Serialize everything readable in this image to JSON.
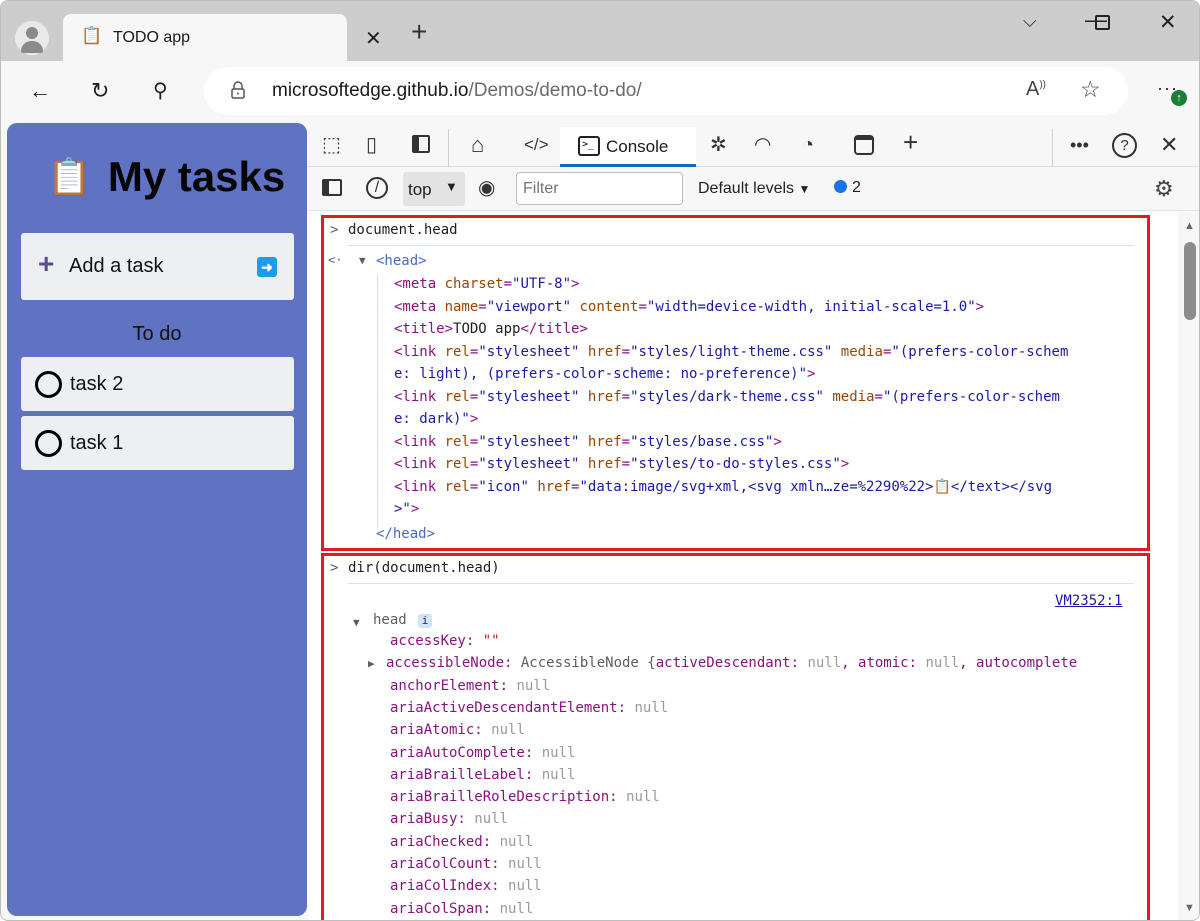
{
  "browser": {
    "tab_title": "TODO app",
    "tab_favicon": "clipboard-icon",
    "new_tab_label": "+",
    "url_host": "microsoftedge.github.io",
    "url_path": "/Demos/demo-to-do/",
    "window_controls": [
      "tab-actions-chevron",
      "minimize",
      "maximize",
      "close"
    ]
  },
  "app": {
    "title": "My tasks",
    "title_icon": "📋",
    "add_task_label": "Add a task",
    "section_heading": "To do",
    "tasks": [
      {
        "label": "task 2",
        "done": false
      },
      {
        "label": "task 1",
        "done": false
      }
    ],
    "colors": {
      "background": "#6072c2",
      "card": "#eeeff3",
      "submit": "#1e9bea"
    }
  },
  "devtools": {
    "toolbar_icons": [
      "inspect-icon",
      "device-emulation-icon",
      "dock-sidebar-icon",
      "welcome-home-icon",
      "elements-icon"
    ],
    "active_tab": "Console",
    "more_tool_icons": [
      "sources-bug-icon",
      "network-wifi-icon",
      "performance-gauge-icon",
      "application-icon",
      "more-tools-plus-icon"
    ],
    "context": "top",
    "filter_placeholder": "Filter",
    "levels_label": "Default levels",
    "message_count": "2",
    "accent": "#0f6cbd",
    "highlight_color": "#e21b23"
  },
  "console": {
    "entry1": {
      "command": "document.head",
      "head_open": "<head>",
      "lines": [
        [
          [
            "tg",
            "<meta "
          ],
          [
            "at",
            "charset"
          ],
          [
            "tg",
            "="
          ],
          [
            "av",
            "\"UTF-8\""
          ],
          [
            "tg",
            ">"
          ]
        ],
        [
          [
            "tg",
            "<meta "
          ],
          [
            "at",
            "name"
          ],
          [
            "tg",
            "="
          ],
          [
            "av",
            "\"viewport\""
          ],
          [
            "tg",
            " "
          ],
          [
            "at",
            "content"
          ],
          [
            "tg",
            "="
          ],
          [
            "av",
            "\"width=device-width, initial-scale=1.0\""
          ],
          [
            "tg",
            ">"
          ]
        ],
        [
          [
            "tg",
            "<title>"
          ],
          [
            "tx",
            "TODO app"
          ],
          [
            "tg",
            "</title>"
          ]
        ],
        [
          [
            "tg",
            "<link "
          ],
          [
            "at",
            "rel"
          ],
          [
            "tg",
            "="
          ],
          [
            "av",
            "\"stylesheet\""
          ],
          [
            "tg",
            " "
          ],
          [
            "at",
            "href"
          ],
          [
            "tg",
            "="
          ],
          [
            "av",
            "\"styles/light-theme.css\""
          ],
          [
            "tg",
            " "
          ],
          [
            "at",
            "media"
          ],
          [
            "tg",
            "="
          ],
          [
            "av",
            "\"(prefers-color-schem"
          ]
        ],
        [
          [
            "av",
            "e: light), (prefers-color-scheme: no-preference)\""
          ],
          [
            "tg",
            ">"
          ]
        ],
        [
          [
            "tg",
            "<link "
          ],
          [
            "at",
            "rel"
          ],
          [
            "tg",
            "="
          ],
          [
            "av",
            "\"stylesheet\""
          ],
          [
            "tg",
            " "
          ],
          [
            "at",
            "href"
          ],
          [
            "tg",
            "="
          ],
          [
            "av",
            "\"styles/dark-theme.css\""
          ],
          [
            "tg",
            " "
          ],
          [
            "at",
            "media"
          ],
          [
            "tg",
            "="
          ],
          [
            "av",
            "\"(prefers-color-schem"
          ]
        ],
        [
          [
            "av",
            "e: dark)\""
          ],
          [
            "tg",
            ">"
          ]
        ],
        [
          [
            "tg",
            "<link "
          ],
          [
            "at",
            "rel"
          ],
          [
            "tg",
            "="
          ],
          [
            "av",
            "\"stylesheet\""
          ],
          [
            "tg",
            " "
          ],
          [
            "at",
            "href"
          ],
          [
            "tg",
            "="
          ],
          [
            "av",
            "\"styles/base.css\""
          ],
          [
            "tg",
            ">"
          ]
        ],
        [
          [
            "tg",
            "<link "
          ],
          [
            "at",
            "rel"
          ],
          [
            "tg",
            "="
          ],
          [
            "av",
            "\"stylesheet\""
          ],
          [
            "tg",
            " "
          ],
          [
            "at",
            "href"
          ],
          [
            "tg",
            "="
          ],
          [
            "av",
            "\"styles/to-do-styles.css\""
          ],
          [
            "tg",
            ">"
          ]
        ],
        [
          [
            "tg",
            "<link "
          ],
          [
            "at",
            "rel"
          ],
          [
            "tg",
            "="
          ],
          [
            "av",
            "\"icon\""
          ],
          [
            "tg",
            " "
          ],
          [
            "at",
            "href"
          ],
          [
            "tg",
            "="
          ],
          [
            "av",
            "\"data:image/svg+xml,<svg xmln…ze=%2290%22>📋</text></svg"
          ]
        ],
        [
          [
            "av",
            ">\""
          ],
          [
            "tg",
            ">"
          ]
        ]
      ],
      "head_close": "</head>"
    },
    "entry2": {
      "command": "dir(document.head)",
      "source_link": "VM2352:1",
      "object_name": "head",
      "info_badge": "i",
      "props": [
        {
          "key": "accessKey",
          "value": "\"\"",
          "type": "str",
          "expandable": false
        },
        {
          "key": "accessibleNode",
          "value": "AccessibleNode {activeDescendant: null, atomic: null, autocomplete",
          "type": "obj",
          "expandable": true
        },
        {
          "key": "anchorElement",
          "value": "null",
          "type": "null",
          "expandable": false
        },
        {
          "key": "ariaActiveDescendantElement",
          "value": "null",
          "type": "null",
          "expandable": false
        },
        {
          "key": "ariaAtomic",
          "value": "null",
          "type": "null",
          "expandable": false
        },
        {
          "key": "ariaAutoComplete",
          "value": "null",
          "type": "null",
          "expandable": false
        },
        {
          "key": "ariaBrailleLabel",
          "value": "null",
          "type": "null",
          "expandable": false
        },
        {
          "key": "ariaBrailleRoleDescription",
          "value": "null",
          "type": "null",
          "expandable": false
        },
        {
          "key": "ariaBusy",
          "value": "null",
          "type": "null",
          "expandable": false
        },
        {
          "key": "ariaChecked",
          "value": "null",
          "type": "null",
          "expandable": false
        },
        {
          "key": "ariaColCount",
          "value": "null",
          "type": "null",
          "expandable": false
        },
        {
          "key": "ariaColIndex",
          "value": "null",
          "type": "null",
          "expandable": false
        },
        {
          "key": "ariaColSpan",
          "value": "null",
          "type": "null",
          "expandable": false
        }
      ]
    }
  }
}
